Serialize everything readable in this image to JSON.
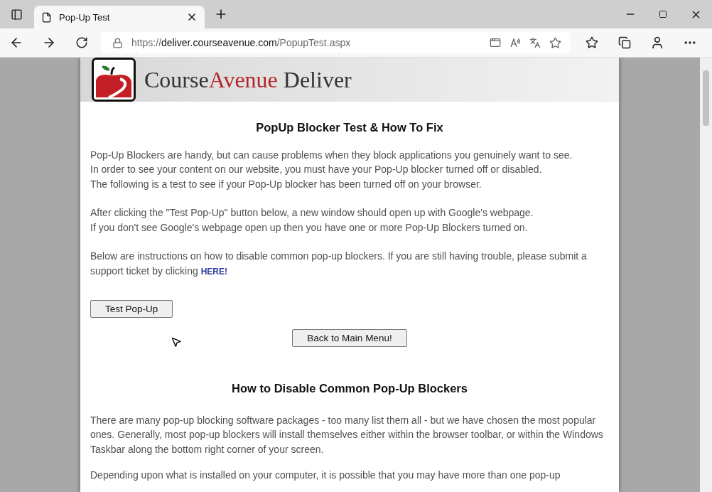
{
  "tab": {
    "title": "Pop-Up Test",
    "selected": true
  },
  "address_bar": {
    "protocol": "https://",
    "domain": "deliver.courseavenue.com",
    "path": "/PopupTest.aspx"
  },
  "logo": {
    "brand_part_1": "Course",
    "brand_part_2": "Avenue",
    "brand_part_3": " Deliver"
  },
  "heading": "PopUp Blocker Test & How To Fix",
  "intro_paragraphs": [
    [
      "Pop-Up Blockers are handy, but can cause problems when they block applications you genuinely want to see.",
      "In order to see your content on our website, you must have your Pop-Up blocker turned off or disabled.",
      "The following is a test to see if your Pop-Up blocker has been turned off on your browser."
    ],
    [
      "After clicking the \"Test Pop-Up\" button below, a new window should open up with Google's webpage.",
      "If you don't see Google's webpage open up then you have one or more Pop-Up Blockers turned on."
    ]
  ],
  "support_text": {
    "before": "Below are instructions on how to disable common pop-up blockers.  If you are still having trouble, please submit a support ticket by clicking ",
    "link": "HERE!"
  },
  "test_button": "Test Pop-Up",
  "back_button": "Back to Main Menu!",
  "heading_2": "How to Disable Common Pop-Up Blockers",
  "body_paragraphs": [
    "There are many pop-up blocking software packages -  too many list them all - but we have chosen the most popular ones. Generally, most pop-up blockers will install themselves either within the browser toolbar, or within the Windows Taskbar along the bottom right corner of your screen.",
    "Depending upon what is installed on your computer, it is possible that you may have more than one pop-up"
  ]
}
